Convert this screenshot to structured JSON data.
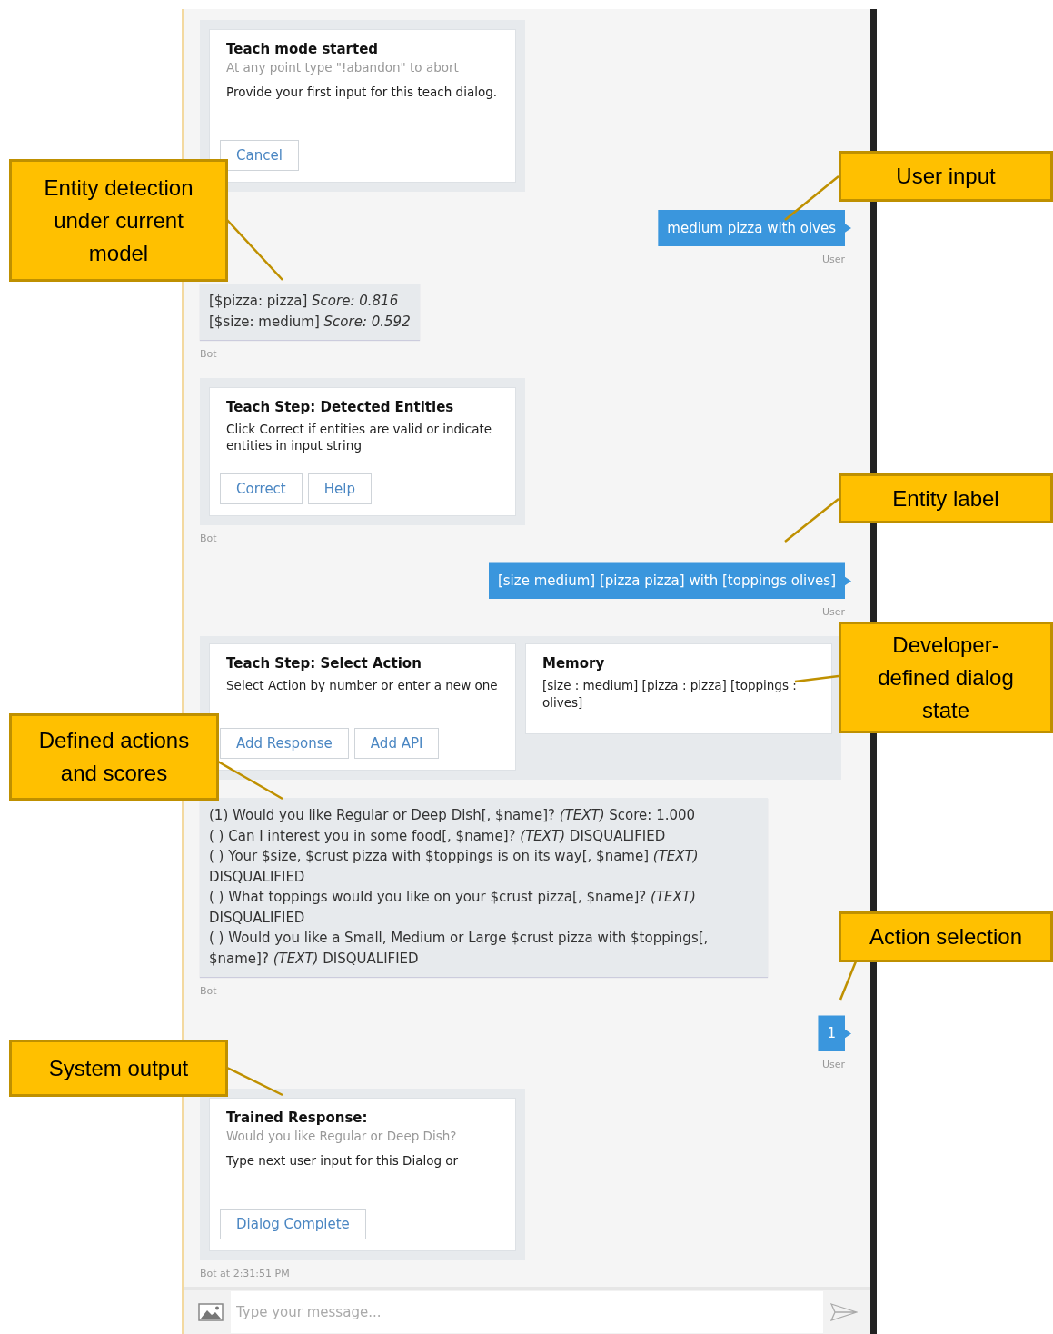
{
  "chat": {
    "messages": [
      {
        "kind": "card",
        "title": "Teach mode started",
        "subtitle": "At any point type \"!abandon\" to abort",
        "text": "Provide your first input for this teach dialog.",
        "buttons": [
          "Cancel"
        ]
      },
      {
        "kind": "user_text",
        "text": "medium pizza with olves",
        "footer": "User"
      },
      {
        "kind": "bot_text",
        "lines": [
          "[$pizza: pizza] *Score: 0.816*",
          "[$size: medium] *Score: 0.592*"
        ],
        "footer": "Bot"
      },
      {
        "kind": "card",
        "title": "Teach Step: Detected Entities",
        "text": "Click Correct if entities are valid or indicate entities in input string",
        "buttons": [
          "Correct",
          "Help"
        ],
        "footer": "Bot"
      },
      {
        "kind": "user_text",
        "text": "[size medium] [pizza pizza] with [toppings olives]",
        "footer": "User"
      },
      {
        "kind": "card_pair",
        "cards": [
          {
            "title": "Teach Step: Select Action",
            "text": "Select Action by number or enter a new one",
            "buttons": [
              "Add Response",
              "Add API"
            ]
          },
          {
            "title": "Memory",
            "text": "[size : medium] [pizza : pizza] [toppings : olives]"
          }
        ]
      },
      {
        "kind": "bot_text",
        "lines": [
          "(1) Would you like Regular or Deep Dish[, $name]? *(TEXT)* Score: 1.000",
          "( ) Can I interest you in some food[, $name]? *(TEXT)* DISQUALIFIED",
          "( ) Your $size, $crust pizza with $toppings is on its way[, $name] *(TEXT)* DISQUALIFIED",
          "( ) What toppings would you like on your $crust pizza[, $name]? *(TEXT)* DISQUALIFIED",
          "( ) Would you like a Small, Medium or Large $crust pizza with $toppings[, $name]? *(TEXT)* DISQUALIFIED"
        ],
        "footer": "Bot"
      },
      {
        "kind": "user_text",
        "text": "1",
        "footer": "User"
      },
      {
        "kind": "card",
        "title": "Trained Response:",
        "subtitle": "Would you like Regular or Deep Dish?",
        "text": "Type next user input for this Dialog or",
        "buttons": [
          "Dialog Complete"
        ],
        "footer": "Bot at 2:31:51 PM"
      }
    ],
    "input": {
      "placeholder": "Type your message..."
    }
  },
  "callouts": [
    {
      "text": "Entity detection under current model"
    },
    {
      "text": "User input"
    },
    {
      "text": "Entity label"
    },
    {
      "text": "Developer-defined dialog state"
    },
    {
      "text": "Defined actions and scores"
    },
    {
      "text": "Action selection"
    },
    {
      "text": "System output"
    }
  ]
}
